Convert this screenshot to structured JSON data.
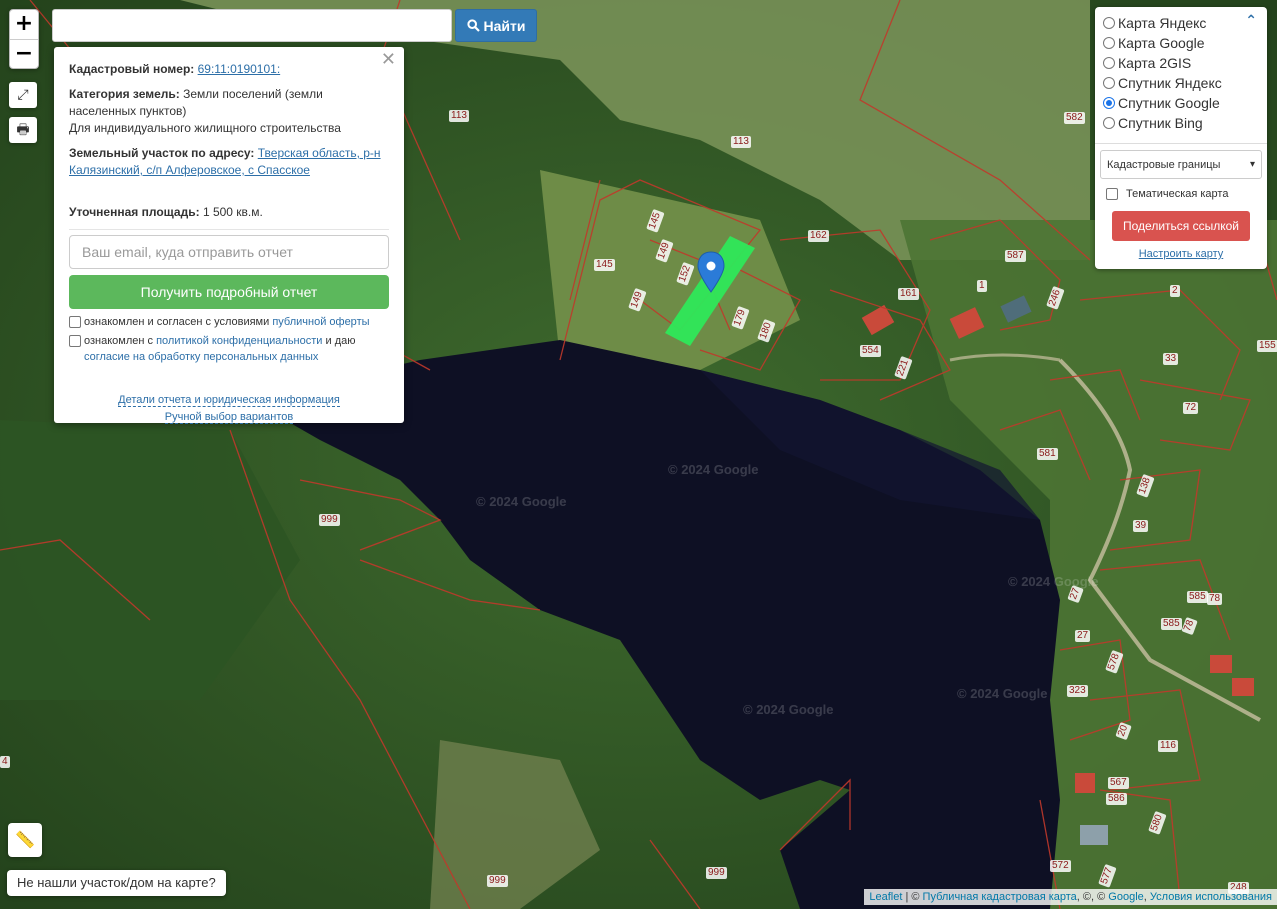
{
  "search": {
    "value": "",
    "button_label": "Найти"
  },
  "zoom": {
    "in": "+",
    "out": "−"
  },
  "popup": {
    "cadastral_label": "Кадастровый номер:",
    "cadastral_value": "69:11:0190101:",
    "category_label": "Категория земель:",
    "category_value": "Земли поселений (земли населенных пунктов)",
    "use_value": "Для индивидуального жилищного строительства",
    "address_label": "Земельный участок по адресу:",
    "address_value": "Тверская область, р-н Калязинский, с/п Алферовское, с Спасское",
    "area_label": "Уточненная площадь:",
    "area_value": "1 500 кв.м.",
    "email_placeholder": "Ваш email, куда отправить отчет",
    "report_button": "Получить подробный отчет",
    "check1_text": "ознакомлен и согласен с условиями",
    "check1_link": "публичной оферты",
    "check2_text": "ознакомлен с",
    "check2_link": "политикой конфиденциальности",
    "check2_text2": "и даю",
    "check2_link2": "согласие на обработку персональных данных",
    "details_link": "Детали отчета и юридическая информация",
    "manual_link": "Ручной выбор вариантов"
  },
  "layers": {
    "options": [
      {
        "label": "Карта Яндекс",
        "selected": false
      },
      {
        "label": "Карта Google",
        "selected": false
      },
      {
        "label": "Карта 2GIS",
        "selected": false
      },
      {
        "label": "Спутник Яндекс",
        "selected": false
      },
      {
        "label": "Спутник Google",
        "selected": true
      },
      {
        "label": "Спутник Bing",
        "selected": false
      }
    ],
    "overlay_select": "Кадастровые границы",
    "thematic_label": "Тематическая карта",
    "share_button": "Поделиться ссылкой",
    "setup_link": "Настроить карту"
  },
  "not_found_button": "Не нашли участок/дом на карте?",
  "attribution": {
    "leaflet": "Leaflet",
    "sep": " | © ",
    "pkk": "Публичная кадастровая карта",
    "mid": ", ©, © ",
    "google": "Google",
    "comma": ", ",
    "terms": "Условия использования"
  },
  "watermark": "© 2024 Google",
  "parcel_labels": [
    "113",
    "113",
    "582",
    "145",
    "149",
    "145",
    "152",
    "149",
    "179",
    "180",
    "162",
    "161",
    "587",
    "1",
    "246",
    "2",
    "554",
    "221",
    "33",
    "155",
    "72",
    "581",
    "138",
    "39",
    "999",
    "27",
    "27",
    "585",
    "78",
    "585",
    "78",
    "578",
    "323",
    "20",
    "116",
    "567",
    "586",
    "580",
    "572",
    "577",
    "999",
    "999",
    "248",
    "4"
  ],
  "colors": {
    "accent_blue": "#337ab7",
    "report_green": "#5cb85c",
    "share_red": "#d9534f",
    "parcel_border": "#c0392b",
    "selected_parcel": "#2ee85a",
    "marker": "#2b7bd8"
  }
}
